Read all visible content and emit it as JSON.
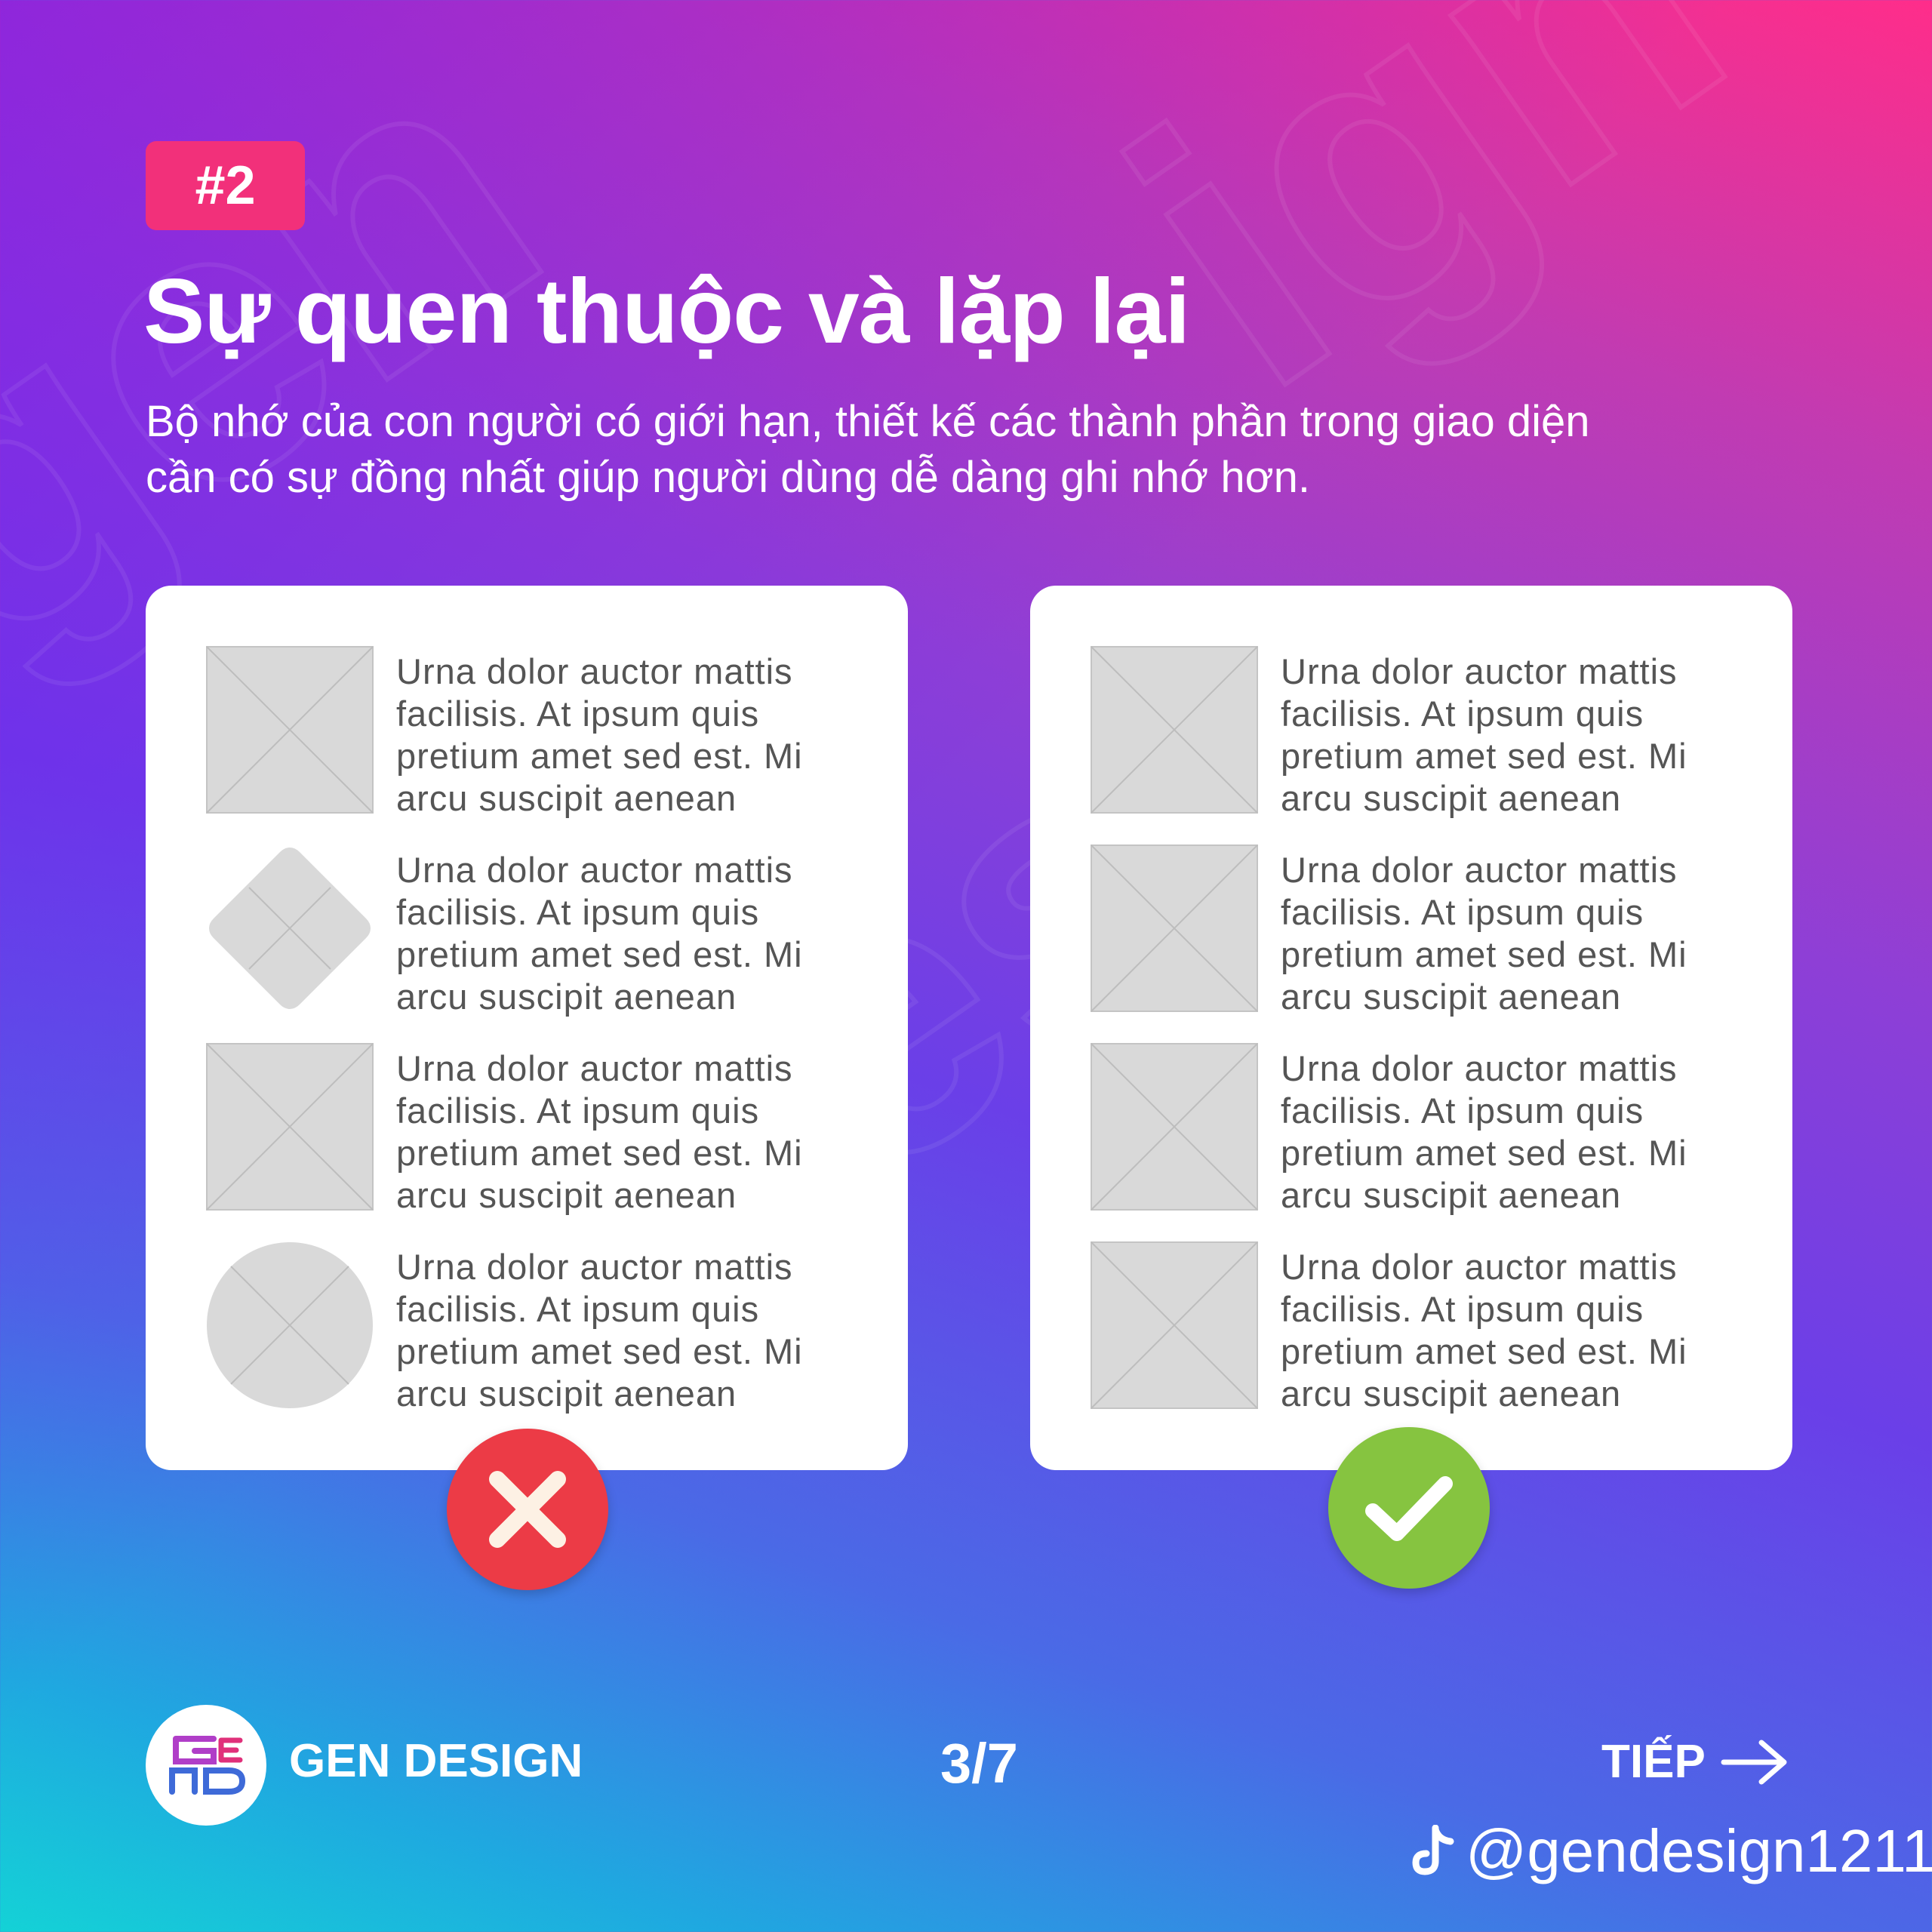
{
  "tag": "#2",
  "title": "Sự quen thuộc và lặp lại",
  "subtitle_line1": "Bộ nhớ của con người có giới hạn, thiết kế các thành phần trong giao diện",
  "subtitle_line2": "cần có sự đồng nhất giúp người dùng dễ dàng ghi nhớ hơn.",
  "cards": {
    "left": {
      "verdict": "incorrect",
      "items": [
        {
          "shape": "square",
          "text": "Urna dolor auctor mattis facilisis. At ipsum quis pretium amet sed est. Mi arcu suscipit aenean"
        },
        {
          "shape": "diamond",
          "text": "Urna dolor auctor mattis facilisis. At ipsum quis pretium amet sed est. Mi arcu suscipit aenean"
        },
        {
          "shape": "square",
          "text": "Urna dolor auctor mattis facilisis. At ipsum quis pretium amet sed est. Mi arcu suscipit aenean"
        },
        {
          "shape": "circle",
          "text": "Urna dolor auctor mattis facilisis. At ipsum quis pretium amet sed est. Mi arcu suscipit aenean"
        }
      ]
    },
    "right": {
      "verdict": "correct",
      "items": [
        {
          "shape": "square",
          "text": "Urna dolor auctor mattis facilisis. At ipsum quis pretium amet sed est. Mi arcu suscipit aenean"
        },
        {
          "shape": "square",
          "text": "Urna dolor auctor mattis facilisis. At ipsum quis pretium amet sed est. Mi arcu suscipit aenean"
        },
        {
          "shape": "square",
          "text": "Urna dolor auctor mattis facilisis. At ipsum quis pretium amet sed est. Mi arcu suscipit aenean"
        },
        {
          "shape": "square",
          "text": "Urna dolor auctor mattis facilisis. At ipsum quis pretium amet sed est. Mi arcu suscipit aenean"
        }
      ]
    }
  },
  "footer": {
    "brand": "GEN DESIGN",
    "page": "3/7",
    "next": "TIẾP",
    "handle": "@gendesign1211"
  },
  "icons": {
    "incorrect": "close-icon",
    "correct": "check-icon",
    "next": "arrow-right-icon",
    "social": "tiktok-icon"
  },
  "colors": {
    "tag": "#f2307a",
    "incorrect": "#ec3b46",
    "correct": "#86c440",
    "placeholder": "#d9d9d9"
  }
}
